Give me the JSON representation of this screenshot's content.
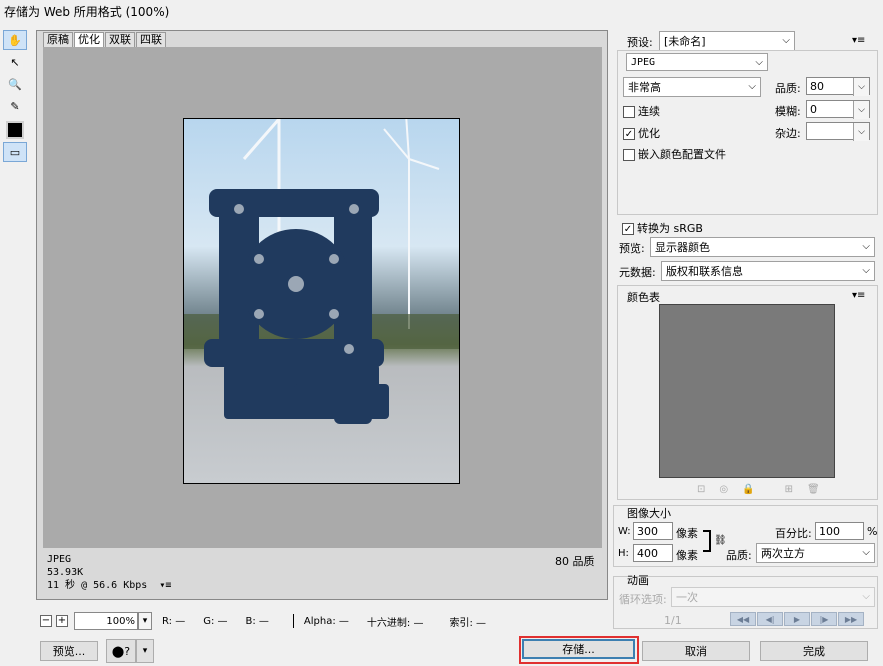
{
  "window": {
    "title": "存储为 Web 所用格式 (100%)"
  },
  "tabs": [
    "原稿",
    "优化",
    "双联",
    "四联"
  ],
  "preview_info": {
    "format": "JPEG",
    "size": "53.93K",
    "time": "11 秒 @ 56.6 Kbps",
    "menu_glyph": "▾≡",
    "quality": "80 品质"
  },
  "statusbar": {
    "zoom": "100%",
    "r": "R: —",
    "g": "G: —",
    "b": "B: —",
    "alpha": "Alpha: —",
    "hex": "十六进制: —",
    "index": "索引: —"
  },
  "bottom_buttons": {
    "preview": "预览...",
    "save": "存储...",
    "cancel": "取消",
    "done": "完成"
  },
  "settings": {
    "preset_label": "预设:",
    "preset_value": "[未命名]",
    "format": "JPEG",
    "compression": "非常高",
    "quality_label": "品质:",
    "quality_value": "80",
    "progressive_label": "连续",
    "blur_label": "模糊:",
    "blur_value": "0",
    "optimized_label": "优化",
    "matte_label": "杂边:",
    "matte_value": "",
    "embed_profile_label": "嵌入颜色配置文件",
    "convert_srgb_label": "转换为 sRGB",
    "preview_label": "预览:",
    "preview_value": "显示器颜色",
    "metadata_label": "元数据:",
    "metadata_value": "版权和联系信息"
  },
  "checkboxes": {
    "progressive": false,
    "optimized": true,
    "embed_profile": false,
    "convert_srgb": true
  },
  "color_table": {
    "title": "颜色表"
  },
  "image_size": {
    "title": "图像大小",
    "w_label": "W:",
    "w_value": "300",
    "h_label": "H:",
    "h_value": "400",
    "unit": "像素",
    "percent_label": "百分比:",
    "percent_value": "100",
    "percent_sign": "%",
    "quality_label": "品质:",
    "quality_value": "两次立方"
  },
  "animation": {
    "title": "动画",
    "loop_label": "循环选项:",
    "loop_value": "一次",
    "frame_counter": "1/1"
  },
  "colors": {
    "accent": "#3c7fb1",
    "highlight": "#e03030",
    "canvas": "#aaaaaa"
  }
}
